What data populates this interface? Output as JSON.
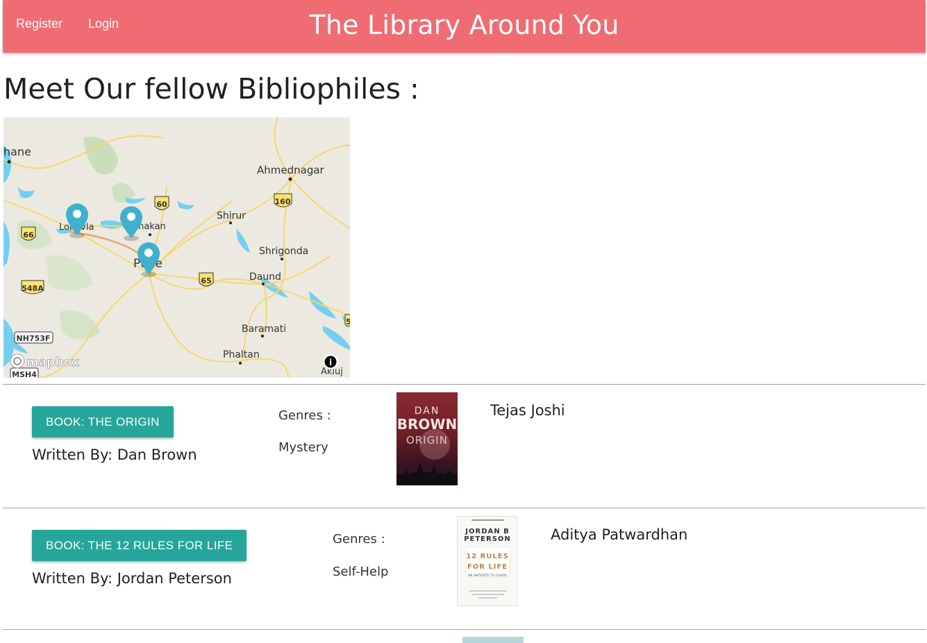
{
  "nav": {
    "register": "Register",
    "login": "Login",
    "title": "The Library Around You"
  },
  "page": {
    "heading": "Meet Our fellow Bibliophiles :"
  },
  "map": {
    "attribution": "mapbox",
    "info_symbol": "i",
    "places": [
      "hane",
      "Ahmednagar",
      "Shirur",
      "Lonavla",
      "Chakan",
      "Pune",
      "Shrigonda",
      "Daund",
      "Baramati",
      "Phaltan",
      "Akluj"
    ],
    "road_shields": [
      "60",
      "160",
      "66",
      "65",
      "548A",
      "NH753F",
      "MSH4",
      "5"
    ],
    "marker_count": 3,
    "colors": {
      "marker": "#3fb1ce",
      "land": "#ece9e1",
      "water": "#75cff0",
      "road": "#f6d66e",
      "shield": "#ffe36e"
    }
  },
  "books": [
    {
      "button": "BOOK: THE ORIGIN",
      "author": "Written By: Dan Brown",
      "genres_label": "Genres :",
      "genre": "Mystery",
      "owner": "Tejas Joshi",
      "cover": {
        "line1": "DAN",
        "line2": "BROWN",
        "line3": "ORIGIN"
      }
    },
    {
      "button": "BOOK: THE 12 RULES FOR LIFE",
      "author": "Written By: Jordan Peterson",
      "genres_label": "Genres :",
      "genre": "Self-Help",
      "owner": "Aditya Patwardhan",
      "cover": {
        "line1": "JORDAN B",
        "line2": "PETERSON",
        "line3": "12 RULES",
        "line4": "FOR LIFE",
        "line5": "AN ANTIDOTE TO CHAOS"
      }
    }
  ],
  "colors": {
    "navbar": "#ef6c73",
    "button": "#26a69a"
  }
}
